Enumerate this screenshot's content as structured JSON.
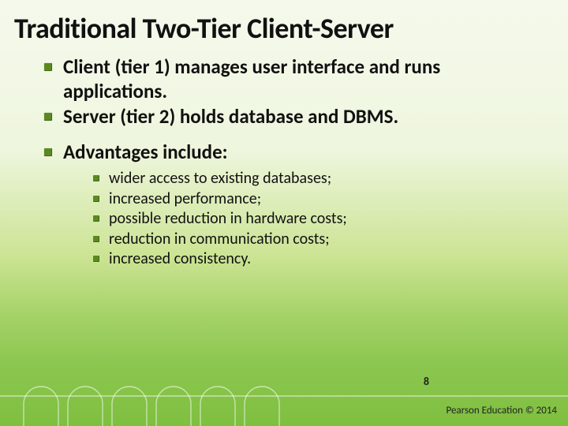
{
  "title": "Traditional Two-Tier Client-Server",
  "bullets": [
    {
      "text": "Client (tier 1) manages user interface and runs applications."
    },
    {
      "text": "Server (tier 2) holds database and DBMS."
    },
    {
      "text": "Advantages include:"
    }
  ],
  "sub_bullets": [
    "wider access to existing databases;",
    "increased performance;",
    "possible reduction in hardware costs;",
    "reduction in communication costs;",
    "increased consistency."
  ],
  "page_number": "8",
  "copyright": "Pearson Education © 2014"
}
